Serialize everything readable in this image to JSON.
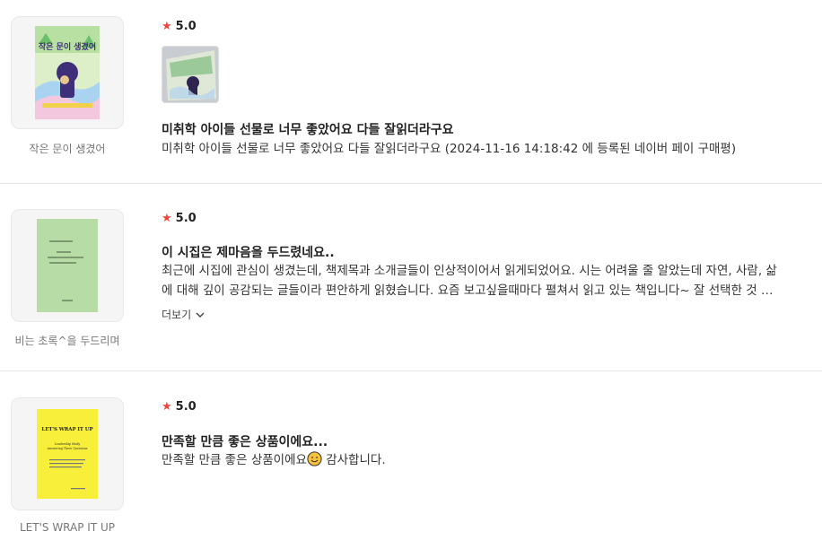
{
  "reviews": [
    {
      "product_name": "작은 문이 생겼어",
      "cover_title": "작은 문이 생겼어",
      "rating": "5.0",
      "title": "미취학 아이들 선물로 너무 좋았어요 다들 잘읽더라구요",
      "body": "미취학 아이들 선물로 너무 좋았어요 다들 잘읽더라구요 (2024-11-16 14:18:42 에 등록된 네이버 페이 구매평)",
      "has_photo": true
    },
    {
      "product_name": "비는 초록^을 두드리며",
      "rating": "5.0",
      "title": "이 시집은 제마음을 두드렸네요..",
      "body": "최근에 시집에 관심이 생겼는데, 책제목과 소개글들이 인상적이어서 읽게되었어요. 시는 어려울 줄 알았는데 자연, 사람, 삶에 대해 깊이 공감되는 글들이라 편안하게 읽혔습니다.  요즘 보고싶을때마다 펼쳐서 읽고 있는 책입니다~ 잘 선택한 것 같아요.",
      "more_label": "더보기"
    },
    {
      "product_name": "LET'S WRAP IT UP",
      "cover_title": "LET'S WRAP IT UP",
      "cover_subtitle": "Leadership Study Answering Three Questions",
      "rating": "5.0",
      "title": "만족할 만큼 좋은 상품이에요...",
      "body_before": "만족할 만큼 좋은 상품이에요",
      "body_after": " 감사합니다."
    }
  ],
  "colors": {
    "star": "#f04438",
    "divider": "#e6e6e6"
  },
  "icons": {
    "star": "star-icon",
    "chevron": "chevron-down-icon",
    "emoji": "smiling-face-icon"
  }
}
